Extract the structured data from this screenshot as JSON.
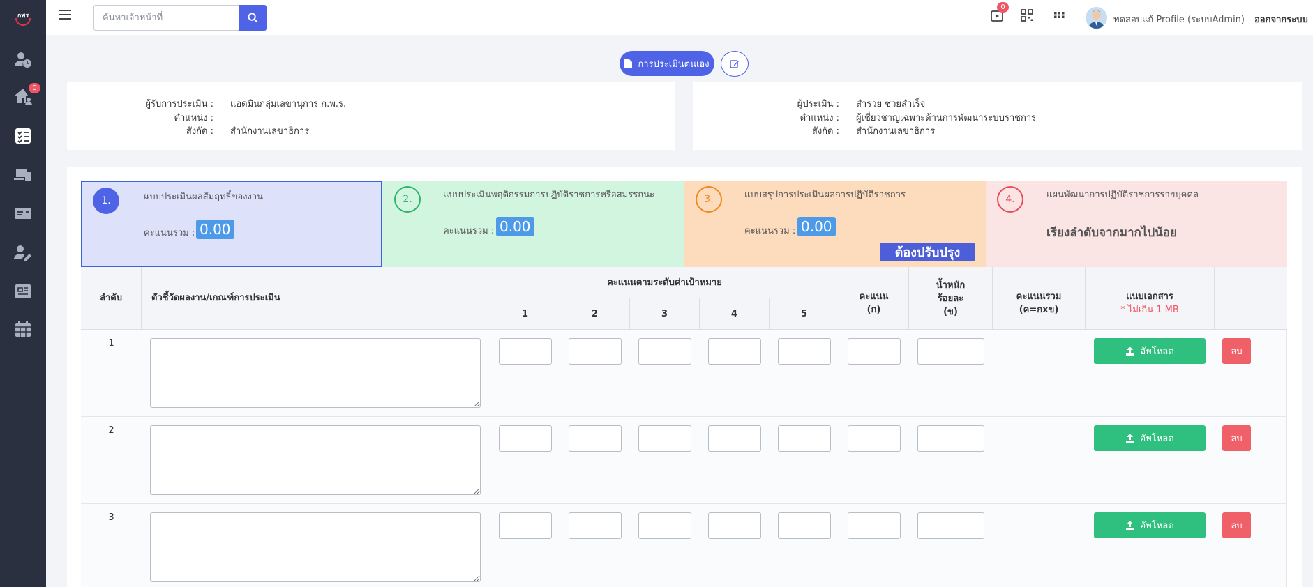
{
  "topbar": {
    "search_placeholder": "ค้นหาเจ้าหน้าที่",
    "notification_count": "0",
    "profile_name": "ทดสอบแก้ Profile (ระบบAdmin)",
    "logout_label": "ออกจากระบบ"
  },
  "sidebar": {
    "logo_text": "กพร",
    "badge_count": "0"
  },
  "actions": {
    "self_assess_label": "การประเมินตนเอง"
  },
  "receiver": {
    "name_label": "ผู้รับการประเมิน :",
    "name_value": "แอดมินกลุ่มเลขานุการ ก.พ.ร.",
    "position_label": "ตำแหน่ง :",
    "position_value": "",
    "dept_label": "สังกัด :",
    "dept_value": "สำนักงานเลขาธิการ"
  },
  "assessor": {
    "name_label": "ผู้ประเมิน :",
    "name_value": "สำรวย ช่วยสำเร็จ",
    "position_label": "ตำแหน่ง :",
    "position_value": "ผู้เชี่ยวชาญเฉพาะด้านการพัฒนาระบบราชการ",
    "dept_label": "สังกัด :",
    "dept_value": "สำนักงานเลขาธิการ"
  },
  "tabs": [
    {
      "num": "1.",
      "title": "แบบประเมินผลสัมฤทธิ์ของงาน",
      "score_label": "คะแนนรวม :",
      "score": "0.00"
    },
    {
      "num": "2.",
      "title": "แบบประเมินพฤติกรรมการปฏิบัติราชการหรือสมรรถนะ",
      "score_label": "คะแนนรวม :",
      "score": "0.00"
    },
    {
      "num": "3.",
      "title": "แบบสรุปการประเมินผลการปฏิบัติราชการ",
      "score_label": "คะแนนรวม :",
      "score": "0.00",
      "badge": "ต้องปรับปรุง"
    },
    {
      "num": "4.",
      "title": "แผนพัฒนาการปฏิบัติราชการรายบุคคล",
      "note": "เรียงลำดับจากมากไปน้อย"
    }
  ],
  "colors": {
    "primary": "#4f63e6",
    "tab1_bg": "#dde1fa",
    "tab2_bg": "#d2f5df",
    "tab3_bg": "#fddcbd",
    "tab4_bg": "#fbe4e4",
    "upload": "#2fbf7e",
    "delete": "#f06068"
  },
  "table": {
    "col_seq": "ลำดับ",
    "col_criteria": "ตัวชี้วัดผลงาน/เกณฑ์การประเมิน",
    "col_target_group": "คะแนนตามระดับค่าเป้าหมาย",
    "target_levels": [
      "1",
      "2",
      "3",
      "4",
      "5"
    ],
    "col_score": "คะแนน",
    "col_score_sub": "(ก)",
    "col_weight": "น้ำหนัก",
    "col_weight_mid": "ร้อยละ",
    "col_weight_sub": "(ข)",
    "col_total": "คะแนนรวม",
    "col_total_sub": "(ค=กxข)",
    "col_attach": "แนบเอกสาร",
    "col_attach_note": "* ไม่เกิน 1 MB",
    "upload_label": "อัพโหลด",
    "delete_label": "ลบ",
    "rows": [
      "1",
      "2",
      "3"
    ]
  }
}
